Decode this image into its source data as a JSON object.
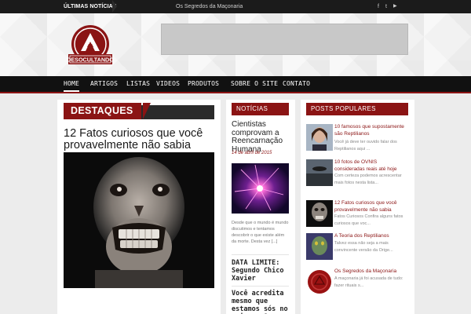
{
  "topbar": {
    "label": "ÚLTIMAS NOTÍCIAS",
    "ticker": "Os Segredos da Maçonaria",
    "social": [
      {
        "icon": "facebook-icon",
        "glyph": "f"
      },
      {
        "icon": "twitter-icon",
        "glyph": "t"
      },
      {
        "icon": "youtube-icon",
        "glyph": "▶"
      }
    ]
  },
  "logo": {
    "text": "DESOCULTANDO",
    "color": "#8b1414"
  },
  "nav": {
    "items": [
      "HOME",
      "ARTIGOS",
      "LISTAS",
      "VIDEOS",
      "PRODUTOS",
      "SOBRE O SITE",
      "CONTATO"
    ],
    "active": "HOME"
  },
  "destaques": {
    "heading": "DESTAQUES",
    "title": "12 Fatos curiosos que você provavelmente não sabia"
  },
  "noticias": {
    "heading": "NOTÍCIAS",
    "title": "Cientistas comprovam a Reencarnação Humana",
    "date": "14 de abril de 2015",
    "excerpt": "Desde que o mundo é mundo discutimos e tentamos descobrir o que existe além da morte. Desta vez [...]",
    "title2": "DATA LIMITE: Segundo Chico Xavier",
    "title3": "Você acredita mesmo que estamos sós no universo?"
  },
  "populares": {
    "heading": "POSTS POPULARES",
    "items": [
      {
        "title": "10 famosos que supostamente são Reptilianos",
        "excerpt": "Você já deve ter ouvido falar dos Reptilianos aqui ..."
      },
      {
        "title": "10 fotos de OVNIS consideradas reais até hoje",
        "excerpt": "Com certeza podemos acrescentar mais fotos nesta lista..."
      },
      {
        "title": "12 Fatos curiosos que você provavelmente não sabia",
        "excerpt": "Fatos Curiosos Confira alguns fatos curiosos que voc..."
      },
      {
        "title": "A Teoria dos Reptilianos",
        "excerpt": "Talvez essa não seja a mais convincente versão da Orige..."
      },
      {
        "title": "Os Segredos da Maçonaria",
        "excerpt": "A maçonaria já foi acusada de tudo: fazer rituais s..."
      }
    ]
  },
  "colors": {
    "accent": "#8b1414",
    "dark": "#111111",
    "topbar": "#1b1b1b"
  }
}
